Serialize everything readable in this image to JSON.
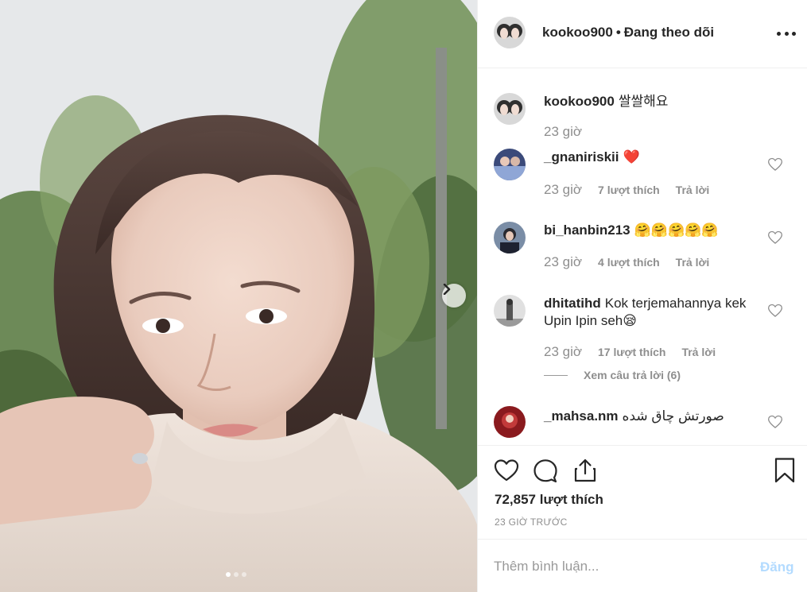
{
  "post": {
    "username": "kookoo900",
    "separator": "•",
    "follow_status": "Đang theo dõi"
  },
  "caption": {
    "username": "kookoo900",
    "text": "쌀쌀해요",
    "time": "23 giờ"
  },
  "comments": [
    {
      "username": "_gnaniriskii",
      "text": "❤️",
      "time": "23 giờ",
      "likes": "7 lượt thích",
      "reply": "Trả lời"
    },
    {
      "username": "bi_hanbin213",
      "text": "🤗🤗🤗🤗🤗",
      "time": "23 giờ",
      "likes": "4 lượt thích",
      "reply": "Trả lời"
    },
    {
      "username": "dhitatihd",
      "text": "Kok terjemahannya kek Upin Ipin seh😪",
      "time": "23 giờ",
      "likes": "17 lượt thích",
      "reply": "Trả lời",
      "view_replies": "Xem câu trả lời (6)"
    },
    {
      "username": "_mahsa.nm",
      "text": "صورتش چاق شده"
    }
  ],
  "likes_total": "72,857 lượt thích",
  "time_ago": "23 GIỜ TRƯỚC",
  "comment_box": {
    "placeholder": "Thêm bình luận...",
    "post_label": "Đăng",
    "post_label_color": "#b3dbff"
  },
  "icons": {
    "like": "heart-icon",
    "comment": "comment-bubble-icon",
    "share": "share-upload-icon",
    "save": "bookmark-icon",
    "more": "more-options-icon",
    "next": "chevron-right-icon"
  },
  "carousel": {
    "slides": 3,
    "active_slide": 1
  }
}
